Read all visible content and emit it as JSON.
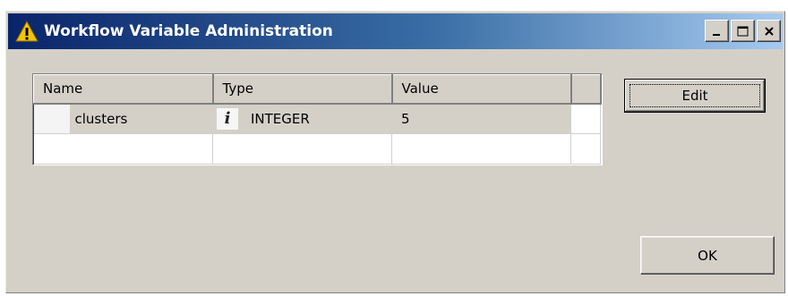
{
  "window": {
    "title": "Workflow Variable Administration",
    "title_icon": "warning-triangle-icon",
    "controls": [
      "minimize-icon",
      "maximize-icon",
      "close-icon"
    ]
  },
  "table": {
    "columns": [
      "Name",
      "Type",
      "Value",
      ""
    ],
    "rows": [
      {
        "name": "clusters",
        "type_icon": "info-icon",
        "type_icon_glyph": "i",
        "type": "INTEGER",
        "value": "5",
        "selected": true
      },
      {
        "name": "",
        "type": "",
        "value": "",
        "selected": false
      }
    ]
  },
  "buttons": {
    "edit": "Edit",
    "ok": "OK"
  },
  "colors": {
    "titlebar_start": "#0a246a",
    "titlebar_end": "#a6caf0",
    "dialog_bg": "#d4d0c8"
  }
}
